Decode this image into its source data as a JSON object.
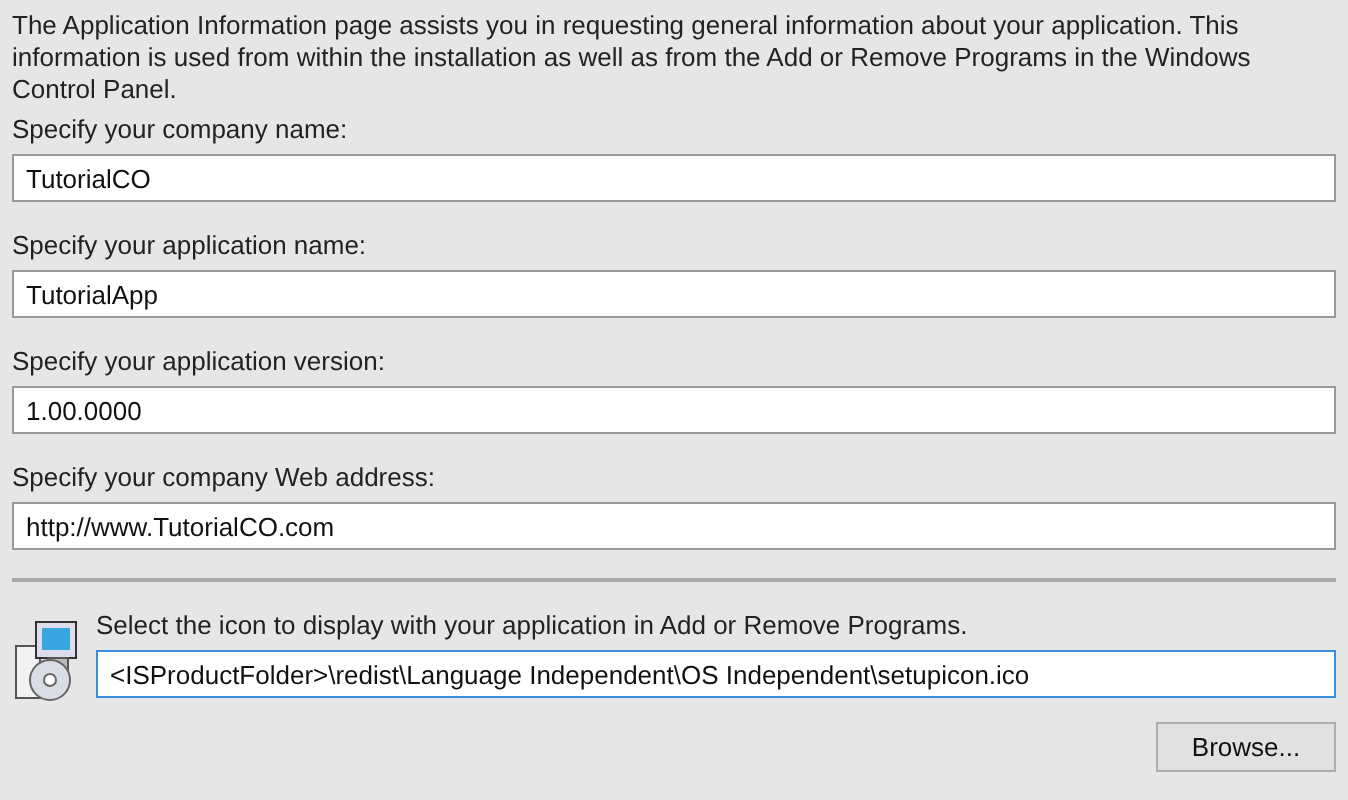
{
  "intro": "The Application Information page assists you in requesting general information about your application. This information is used from within the installation as well as from the Add or Remove Programs in the Windows Control Panel.",
  "fields": [
    {
      "label": "Specify your company name:",
      "value": "TutorialCO"
    },
    {
      "label": "Specify your application name:",
      "value": "TutorialApp"
    },
    {
      "label": "Specify your application version:",
      "value": "1.00.0000"
    },
    {
      "label": "Specify your company Web address:",
      "value": "http://www.TutorialCO.com"
    }
  ],
  "icon_section": {
    "label": "Select the icon to display with your application in Add or Remove Programs.",
    "value": "<ISProductFolder>\\redist\\Language Independent\\OS Independent\\setupicon.ico",
    "focused": true,
    "button": "Browse..."
  }
}
